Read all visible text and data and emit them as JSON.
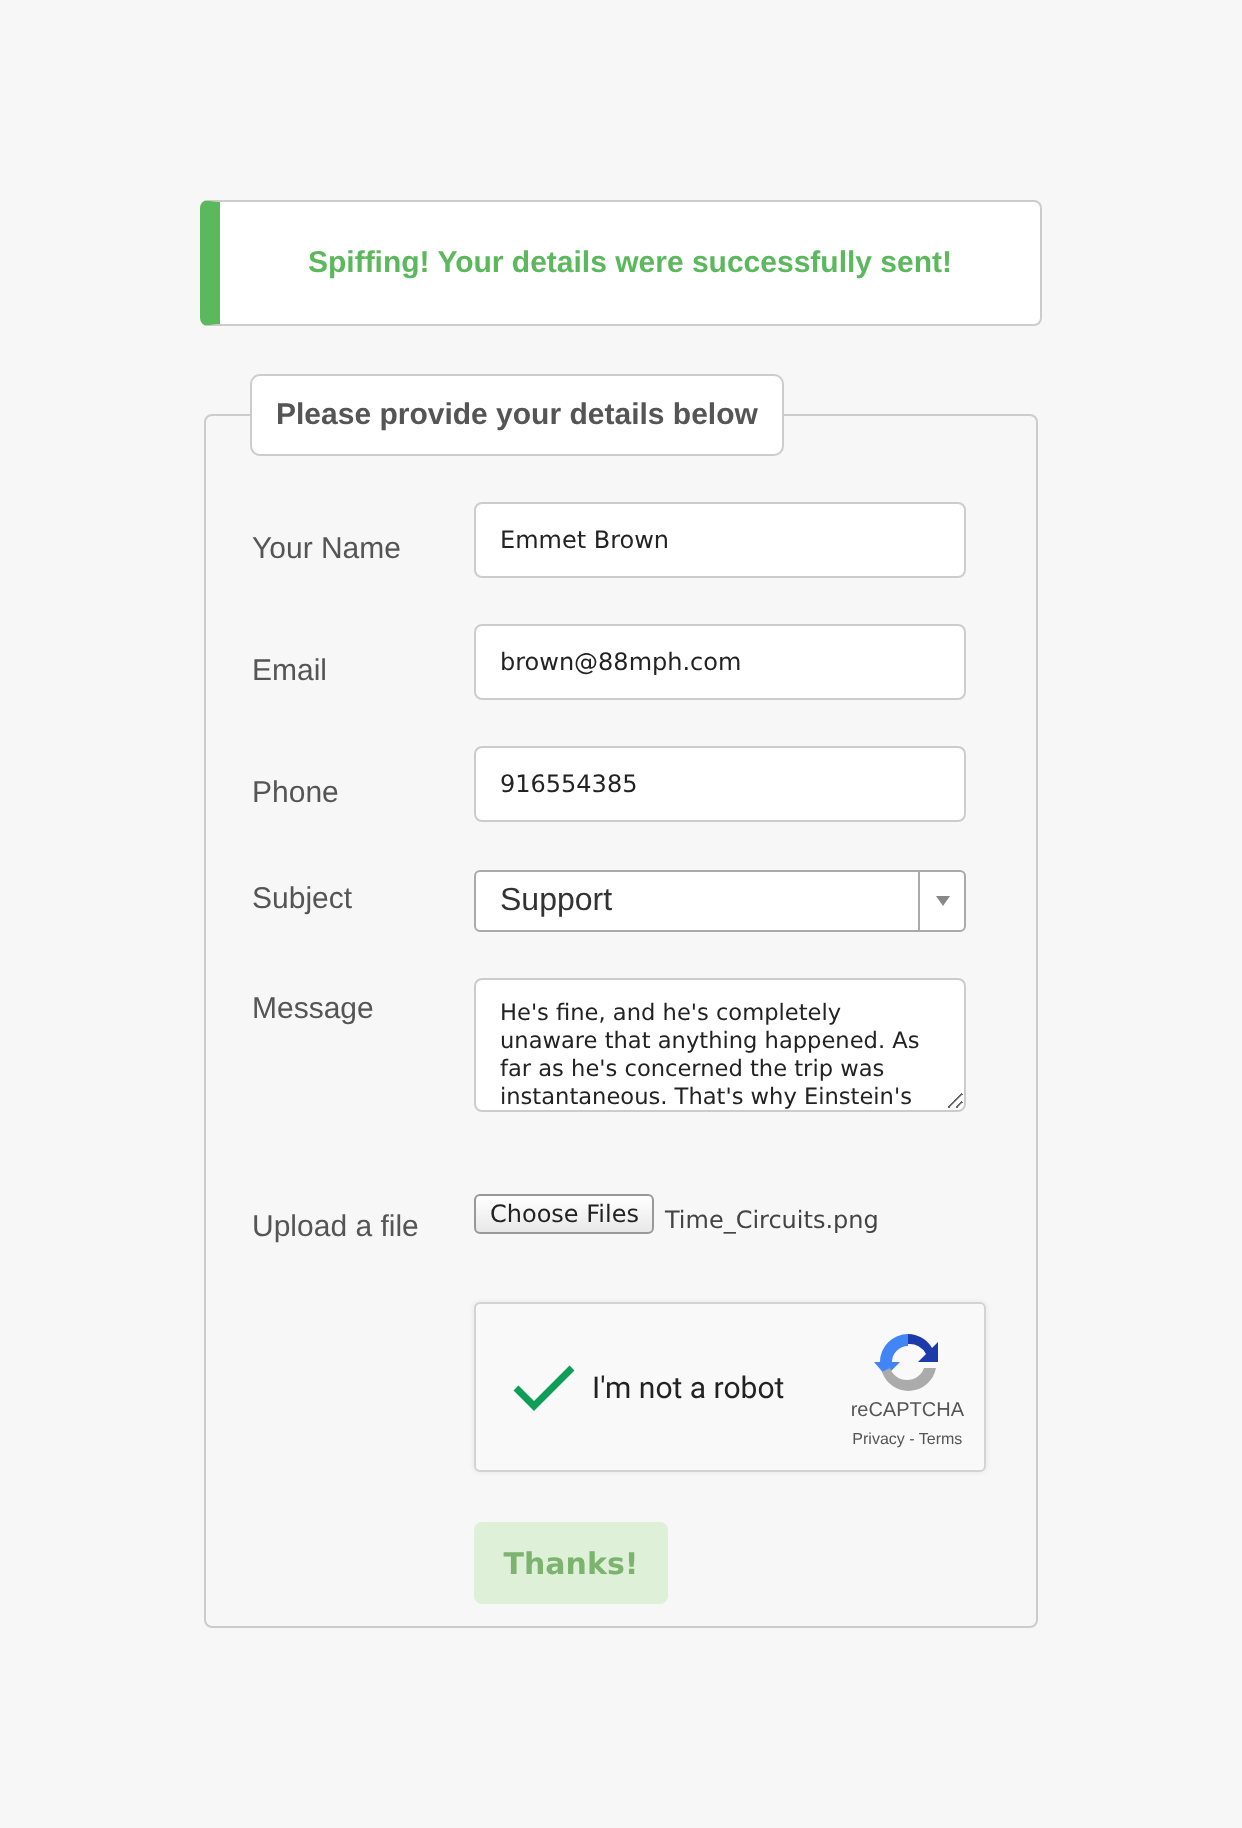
{
  "alert": {
    "message": "Spiffing! Your details were successfully sent!"
  },
  "form": {
    "legend": "Please provide your details below",
    "fields": [
      {
        "kind": "text",
        "label": "Your Name",
        "value": "Emmet Brown"
      },
      {
        "kind": "text",
        "label": "Email",
        "value": "brown@88mph.com"
      },
      {
        "kind": "text",
        "label": "Phone",
        "value": "916554385"
      },
      {
        "kind": "select",
        "label": "Subject",
        "value": "Support"
      },
      {
        "kind": "textarea",
        "label": "Message",
        "value": "He's fine, and he's completely unaware that anything happened. As far as he's concerned the trip was instantaneous. That's why Einstein's"
      },
      {
        "kind": "file",
        "label": "Upload a file",
        "button": "Choose Files",
        "value": "Time_Circuits.png"
      }
    ],
    "captcha": {
      "label": "I'm not a robot",
      "checked": true,
      "brand": "reCAPTCHA",
      "links": "Privacy - Terms"
    },
    "submit": {
      "label": "Thanks!",
      "disabled": true
    }
  }
}
